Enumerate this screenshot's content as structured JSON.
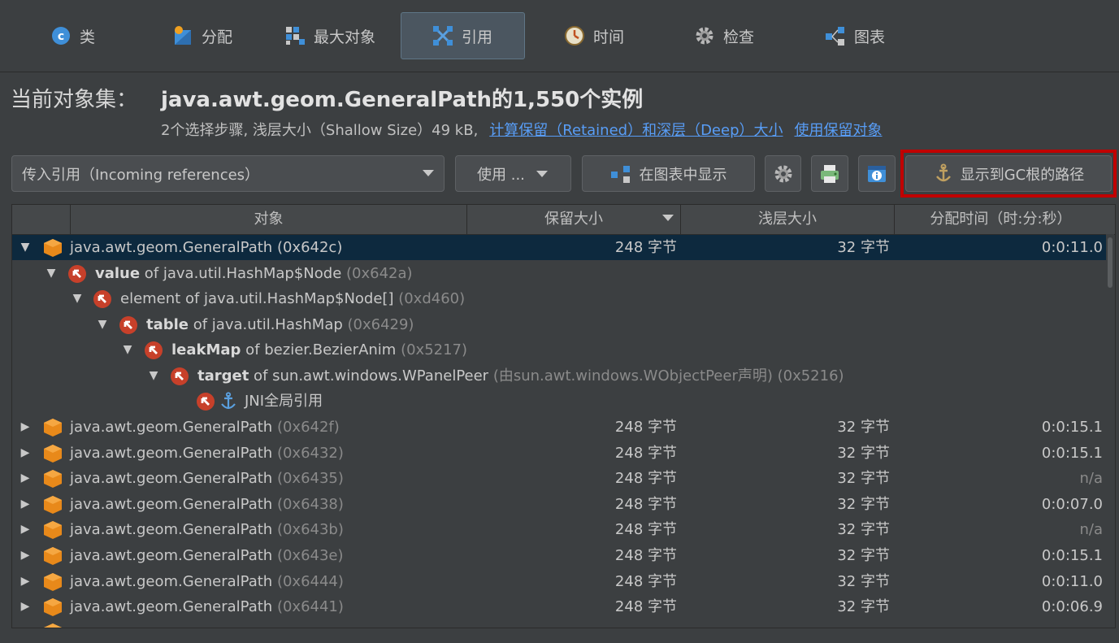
{
  "tabs": [
    {
      "label": "类",
      "icon": "class-c-icon"
    },
    {
      "label": "分配",
      "icon": "allocation-icon"
    },
    {
      "label": "最大对象",
      "icon": "biggest-objects-icon"
    },
    {
      "label": "引用",
      "icon": "references-icon",
      "active": true
    },
    {
      "label": "时间",
      "icon": "clock-icon"
    },
    {
      "label": "检查",
      "icon": "gear-icon"
    },
    {
      "label": "图表",
      "icon": "graph-icon"
    }
  ],
  "header": {
    "label": "当前对象集：",
    "title": "java.awt.geom.GeneralPath的1,550个实例",
    "subtitle": "2个选择步骤, 浅层大小（Shallow Size）49 kB,",
    "link1": "计算保留（Retained）和深层（Deep）大小",
    "link2": "使用保留对象"
  },
  "toolbar": {
    "reference_type": "传入引用（Incoming references）",
    "use_label": "使用 ...",
    "show_in_graph": "在图表中显示",
    "path_to_gc": "显示到GC根的路径"
  },
  "columns": {
    "object": "对象",
    "retained": "保留大小",
    "shallow": "浅层大小",
    "alloc_time": "分配时间（时:分:秒）"
  },
  "tree": {
    "root": {
      "name": "java.awt.geom.GeneralPath",
      "id": "(0x642c)",
      "retained": "248 字节",
      "shallow": "32 字节",
      "time": "0:0:11.0"
    },
    "refs": [
      {
        "field": "value",
        "of": " of java.util.HashMap$Node ",
        "id": "(0x642a)"
      },
      {
        "field": "element",
        "of": " of java.util.HashMap$Node[] ",
        "id": "(0xd460)"
      },
      {
        "field": "table",
        "of": " of java.util.HashMap ",
        "id": "(0x6429)"
      },
      {
        "field": "leakMap",
        "of": " of bezier.BezierAnim ",
        "id": "(0x5217)"
      },
      {
        "field": "target",
        "of": " of sun.awt.windows.WPanelPeer ",
        "id": "(由sun.awt.windows.WObjectPeer声明) (0x5216)"
      }
    ],
    "gc_root": "JNI全局引用"
  },
  "rows": [
    {
      "name": "java.awt.geom.GeneralPath",
      "id": "(0x642f)",
      "retained": "248 字节",
      "shallow": "32 字节",
      "time": "0:0:15.1"
    },
    {
      "name": "java.awt.geom.GeneralPath",
      "id": "(0x6432)",
      "retained": "248 字节",
      "shallow": "32 字节",
      "time": "0:0:15.1"
    },
    {
      "name": "java.awt.geom.GeneralPath",
      "id": "(0x6435)",
      "retained": "248 字节",
      "shallow": "32 字节",
      "time": "n/a"
    },
    {
      "name": "java.awt.geom.GeneralPath",
      "id": "(0x6438)",
      "retained": "248 字节",
      "shallow": "32 字节",
      "time": "0:0:07.0"
    },
    {
      "name": "java.awt.geom.GeneralPath",
      "id": "(0x643b)",
      "retained": "248 字节",
      "shallow": "32 字节",
      "time": "n/a"
    },
    {
      "name": "java.awt.geom.GeneralPath",
      "id": "(0x643e)",
      "retained": "248 字节",
      "shallow": "32 字节",
      "time": "0:0:15.1"
    },
    {
      "name": "java.awt.geom.GeneralPath",
      "id": "(0x6444)",
      "retained": "248 字节",
      "shallow": "32 字节",
      "time": "0:0:11.0"
    },
    {
      "name": "java.awt.geom.GeneralPath",
      "id": "(0x6441)",
      "retained": "248 字节",
      "shallow": "32 字节",
      "time": "0:0:06.9"
    }
  ],
  "colors": {
    "accent": "#589df6",
    "selection": "#0d293e",
    "highlight": "#c00000",
    "cube": "#e8891a",
    "ref": "#c7402a"
  }
}
